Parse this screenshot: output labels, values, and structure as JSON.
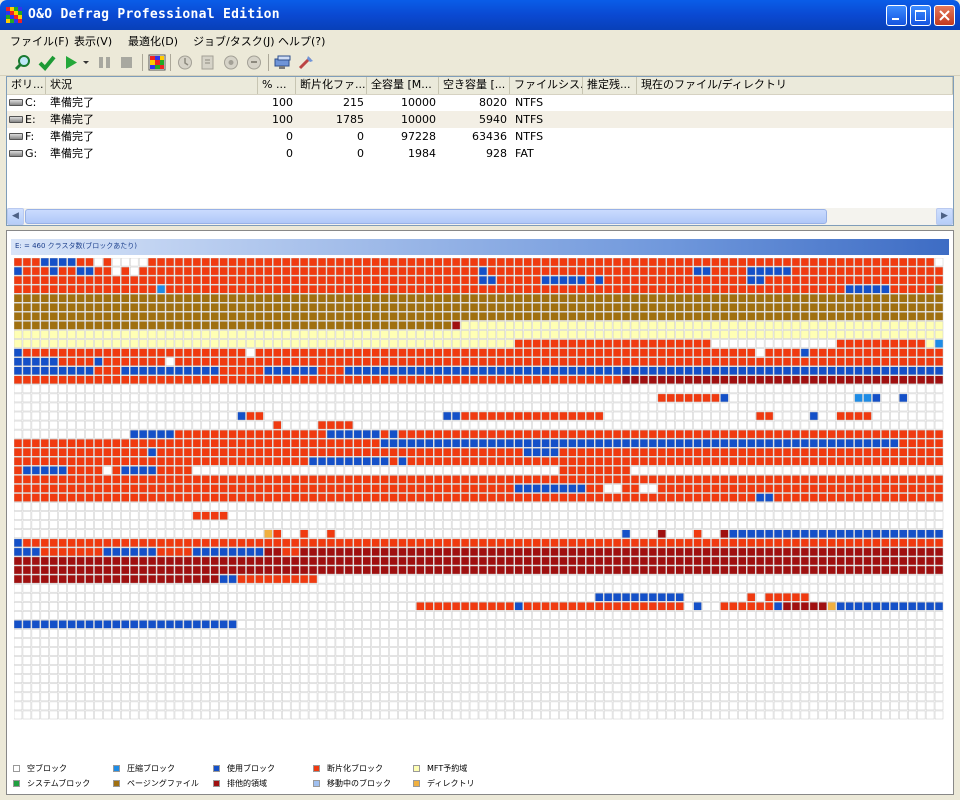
{
  "window": {
    "title": "O&O Defrag Professional Edition"
  },
  "menu": [
    {
      "label": "ファイル(F)"
    },
    {
      "label": "表示(V)"
    },
    {
      "label": "最適化(D)"
    },
    {
      "label": "ジョブ/タスク(J)"
    },
    {
      "label": "ヘルプ(?)"
    }
  ],
  "toolbar": {
    "icons": [
      "analyze-icon",
      "check-icon",
      "start-icon",
      "dropdown-arrow-icon",
      "pause-icon",
      "stop-icon",
      "cluster-view-icon",
      "sched-1-icon",
      "sched-2-icon",
      "sched-3-icon",
      "sched-4-icon",
      "report-icon",
      "settings-icon"
    ]
  },
  "volumes": {
    "columns": [
      "ボリ...",
      "状況",
      "% ...",
      "断片化ファ...",
      "全容量 [M...",
      "空き容量 [...",
      "ファイルシス...",
      "推定残...",
      "現在のファイル/ディレクトリ"
    ],
    "rows": [
      {
        "drive": "C:",
        "status": "準備完了",
        "percent": "100",
        "fragmented": "215",
        "total": "10000",
        "free": "8020",
        "fs": "NTFS",
        "eta": "",
        "current": ""
      },
      {
        "drive": "E:",
        "status": "準備完了",
        "percent": "100",
        "fragmented": "1785",
        "total": "10000",
        "free": "5940",
        "fs": "NTFS",
        "eta": "",
        "current": ""
      },
      {
        "drive": "F:",
        "status": "準備完了",
        "percent": "0",
        "fragmented": "0",
        "total": "97228",
        "free": "63436",
        "fs": "NTFS",
        "eta": "",
        "current": ""
      },
      {
        "drive": "G:",
        "status": "準備完了",
        "percent": "0",
        "fragmented": "0",
        "total": "1984",
        "free": "928",
        "fs": "FAT",
        "eta": "",
        "current": ""
      }
    ],
    "selected_row": 1
  },
  "clustermap": {
    "header": "E: = 460 クラスタ数(ブロックあたり)",
    "grid_cols": 104,
    "grid_rows": 51,
    "colors": {
      "F": "#FFFFFF",
      "R": "#F03A10",
      "B": "#1450C8",
      "N": "#1E8CE6",
      "P": "#A07010",
      "Y": "#FFFFB4",
      "X": "#A01010",
      "S": "#20A040",
      "M": "#A0C0F0",
      "D": "#F0B040"
    },
    "rows": [
      "RRRBBBBRRFRFFFFRRRRRRRRRRRRRRRRRRRRRRRRRRRRRRRRRRRRRRRRRRRRRRRRRRRRRRRRRRRRRRRRRRRRRRRRRRRRRRRRRRRRRRRR",
      "BRRRBRRBBRRFRFRRRRRRRRRRRRRRRRRRRRRRRRRRRRRRRRRRRRRRBRRRRRRRRRRRRRRRRRRRRRRRBBRRRRBBBBBRRRRRRRRRRRRRRRRRR",
      "RRRRRRRRRRRRRRRRRRRRRRRRRRRRRRRRRRRRRRRRRRRRRRRRRRRRBBRRRRRBBBBBRBRRRRRRRRRRRRRRRRBBRRRRRRRRRRRRRRRRRRRR",
      "RRRRRRRRRRRRRRRRNRRRRRRRRRRRRRRRRRRRRRRRRRRRRRRRRRRRRRRRRRRRRRRRRRRRRRRRRRRRRRRRRRRRRRRRRRRRRBBBBBRRRRRP",
      "PPPPPPPPPPPPPPPPPPPPPPPPPPPPPPPPPPPPPPPPPPPPPPPPPPPPPPPPPPPPPPPPPPPPPPPPPPPPPPPPPPPPPPPPPPPPPPPPPPPPPPPPP",
      "PPPPPPPPPPPPPPPPPPPPPPPPPPPPPPPPPPPPPPPPPPPPPPPPPPPPPPPPPPPPPPPPPPPPPPPPPPPPPPPPPPPPPPPPPPPPPPPPPPPPPPPPP",
      "PPPPPPPPPPPPPPPPPPPPPPPPPPPPPPPPPPPPPPPPPPPPPPPPPPPPPPPPPPPPPPPPPPPPPPPPPPPPPPPPPPPPPPPPPPPPPPPPPPPPPPPPP",
      "PPPPPPPPPPPPPPPPPPPPPPPPPPPPPPPPPPPPPPPPPPPPPPPPPXYYYYYYYYYYYYYYYYYYYYYYYYYYYYYYYYYYYYYYYYYYYYYYYYYYYYYYY",
      "YYYYYYYYYYYYYYYYYYYYYYYYYYYYYYYYYYYYYYYYYYYYYYYYYYYYYYYYYYYYYYYYYYYYYYYYYYYYYYYYYYYYYYYYYYYYYYYYYYYYYYYYY",
      "YYYYYYYYYYYYYYYYYYYYYYYYYYYYYYYYYYYYYYYYYYYYYYYYYYYYYYYYRRRRRRRRRRRRRRRRRRRRRRFFFFFFFFFFFFFFRRRRRRRRRRYNY",
      "BRRRRRRRRRRRRRRRRRRRRRRRRRFRRRRRRRRRRRRRRRRRRRRRRRRRRRRRRRRRRRRRRRRRRRRRRRRRRRRRRRRFRRRRBRRRRRRRRRRRRRRRR",
      "BBBBBRRRRBRRRRRRRFRRRRRRRRRRRRRRRRRRRRRRRRRRRRRRRRRRRRRRRRRRRRRRRRRRRRRRRRRRRRRRRRRRRRRRRRRRRRRRRRRRRRRR",
      "BBBBBBBBBRRRBBBBBBBBBBBRRRRRBBBBBBRRRBBBBBBBBBBBBBBBBBBBBBBBBBBBBBBBBBBBBBBBBBBBBBBBBBBBBBBBBBBBBBBBBBBBB",
      "RRRRRRRRRRRRRRRRRRRRRRRRRRRRRRRRRRRRRRRRRRRRRRRRRRRRRRRRRRRRRRRRRRRRXXXXXXXXXXXXXXXXXXXXXXXXXXXXXXXXXXXXX",
      "FFFFFFFFFFFFFFFFFFFFFFFFFFFFFFFFFFFFFFFFFFFFFFFFFFFFFFFFFFFFFFFFFFFFFFFFFFFFFFFFFFFFFFFFFFFFFFFFFFFFFFFFF",
      "FFFFFFFFFFFFFFFFFFFFFFFFFFFFFFFFFFFFFFFFFFFFFFFFFFFFFFFFFFFFFFFFFFFFFFFFRRRRRRRBFFFFFFFFFFFFFFNNBFFBFFFFF",
      "FFFFFFFFFFFFFFFFFFFFFFFFFFFFFFFFFFFFFFFFFFFFFFFFFFFFFFFFFFFFFFFFFFFFFFFFFFFFFFFFFFFFFFFFFFFFFFFFFFFFFFFFF",
      "FFFFFFFFFFFFFFFFFFFFFFFFFBRRFFFFFFFFFFFFFFFFFFFFBBRRRRRRRRRRRRRRRRFFFFFFFFFFFFFFFFFRRFFFFBFFRRRRFFFFFFFFFF",
      "FFFFFFFFFFFFFFFFFFFFFFFFFFFFFRFFFFRRRRFFFFFFFFFFFFFFFFFFFFFFFFFFFFFFFFFFFFFFFFFFFFFFFFFFFFFFFFFFFFFFFFFFF",
      "FFFFFFFFFFFFFBBBBBRRRRRRRRRRRRRRRRRBBBBBBRBRRRRRRRRRRRRRRRRRRRRRRRRRRRRRRRRRRRRRRRRRRRRRRRRRRRRRRRRRRRRR",
      "RRRRRRRRRRRRRRRRRRRRRRRRRRRRRRRRRRRRRRRRRBBBBBBBBBBBBBBBBBBBBBBBBBBBBBBBBBBBBBBBBBBBBBBBBBBBBBBBBBBRRRRRR",
      "RRRRRRRRRRRRRRRBRRRRRRRRRRRRRRRRRRRRRRRRRRRRRRRRRRRRRRRRRBBBBRRRRRRRRRRRRRRRRRRRRRRRRRRRRRRRRRRRRRRRRRRRB",
      "RRRRRRRRRRRRRRRRRRRRRRRRRRRRRRRRRBBBBBBBBBRBRRRRRRRRRRRRRRRRRRRRRRRRRRRRRRRRRRRRRRRRRRRRRRRRRRRRRRRRRRRRR",
      "RBBBBBRRRRFRBBBBRRRRFFFFFFFFFFFFFFFFFFFFFFFFFFFFFFFFFFFFFFFFFRRRRRRRRFFFFFFFFFFFFFFFFFFFFFFFFFFFFFFFFFFFFF",
      "RRRRRRRRRRRRRRRRRRRRRRRRRRRRRRRRRRRRRRRRRRRRRRRRRRRRRRRRRRRRRRRRRRRRRRRRRRRRRRRRRRRRRRRRRRRRRRRRRRRRRRRRR",
      "RRRRRRRRRRRRRRRRRRRRRRRRRRRRRRRRRRRRRRRRRRRRRRRRRRRRRRRRBBBBBBBBRRFFRRFFRRRRRRRRRRRRRRRRRRRRRRRRRRRRRRRRRRR",
      "RRRRRRRRRRRRRRRRRRRRRRRRRRRRRRRRRRRRRRRRRRRRRRRRRRRRRRRRRRRRRRRRRRRRRRRRRRRRRRRRRRRBBRRRRRRRRRRRRRRRRRRRR",
      "FFFFFFFFFFFFFFFFFFFFFFFFFFFFFFFFFFFFFFFFFFFFFFFFFFFFFFFFFFFFFFFFFFFFFFFFFFFFFFFFFFFFFFFFFFFFFFFFFFFFFFFFF",
      "FFFFFFFFFFFFFFFFFFFFRRRRFFFFFFFFFFFFFFFFFFFFFFFFFFFFFFFFFFFFFFFFFFFFFFFFFFFFFFFFFFFFFFFFFFFFFFFFFFFFFFFFF",
      "FFFFFFFFFFFFFFFFFFFFFFFFFFFFFFFFFFFFFFFFFFFFFFFFFFFFFFFFFFFFFFFFFFFFFFFFFFFFFFFFFFFFFFFFFFFFFFFFFFFFFFFFF",
      "FFFFFFFFFFFFFFFFFFFFFFFFFFFFDRFFRFFRFFFFFFFFFFFFFFFFFFFFFFFFFFFFFFFFBFFFXFFFRFFXBBBBBBBBBBBBBBBBBBBBBBBBB",
      "BRRRRRRRRRRRRRRRRRRRRRRRRRRRRRRRRRRRRRRRRRRRRRRRRRRRRRRRRRRRRRRRRRRRRRRRRRRRRRRRRRRRRRRRRRRRRRRRRRRRRRRRR",
      "BBBRRRRRRRBBBBBBRRRRBBBBBBBBXXRRXXXXXXXXXXXXXXXXXXXXXXXXXXXXXXXXXXXXXXXXXXXXXXXXXXXXXXXXXXXXXXXXXXXXXXXXX",
      "XXXXXXXXXXXXXXXXXXXXXXXXXXXXXXXXXXXXXXXXXXXXXXXXXXXXXXXXXXXXXXXXXXXXXXXXXXXXXXXXXXXXXXXXXXXXXXXXXXXXXXXXX",
      "XXXXXXXXXXXXXXXXXXXXXXXXXXXXXXXXXXXXXXXXXXXXXXXXXXXXXXXXXXXXXXXXXXXXXXXXXXXXXXXXXXXXXXXXXXXXXXXXXXXXXXXXX",
      "XXXXXXXXXXXXXXXXXXXXXXXBBRRRRRRRRRFFFFFFFFFFFFFFFFFFFFFFFFFFFFFFFFFFFFFFFFFFFFFFFFFFFFFFFFFFFFFFFFFFFFFF",
      "FFFFFFFFFFFFFFFFFFFFFFFFFFFFFFFFFFFFFFFFFFFFFFFFFFFFFFFFFFFFFFFFFFFFFFFFFFFFFFFFFFFFFFFFFFFFFFFFFFFFFFFFF",
      "FFFFFFFFFFFFFFFFFFFFFFFFFFFFFFFFFFFFFFFFFFFFFFFFFFFFFFFFFFFFFFFFFBBBBBBBBBBFFFFFFFRFRRRRRFFFFFFFFFFFFFFFFF",
      "FFFFFFFFFFFFFFFFFFFFFFFFFFFFFFFFFFFFFFFFFFFFFRRRRRRRRRRRBRRRRRRRRRRRRRRRRRRFBFFRRRRRRBXXXXXDBBBBBBBBBBBBBB",
      "FFFFFFFFFFFFFFFFFFFFFFFFFFFFFFFFFFFFFFFFFFFFFFFFFFFFFFFFFFFFFFFFFFFFFFFFFFFFFFFFFFFFFFFFFFFFFFFFFFFFFFFFF",
      "BBBBBBBBBBBBBBBBBBBBBBBBBFFFFFFFFFFFFFFFFFFFFFFFFFFFFFFFFFFFFFFFFFFFFFFFFFFFFFFFFFFFFFFFFFFFFFFFFFFFFFFFF",
      "FFFFFFFFFFFFFFFFFFFFFFFFFFFFFFFFFFFFFFFFFFFFFFFFFFFFFFFFFFFFFFFFFFFFFFFFFFFFFFFFFFFFFFFFFFFFFFFFFFFFFFFFF",
      "FFFFFFFFFFFFFFFFFFFFFFFFFFFFFFFFFFFFFFFFFFFFFFFFFFFFFFFFFFFFFFFFFFFFFFFFFFFFFFFFFFFFFFFFFFFFFFFFFFFFFFFFF",
      "FFFFFFFFFFFFFFFFFFFFFFFFFFFFFFFFFFFFFFFFFFFFFFFFFFFFFFFFFFFFFFFFFFFFFFFFFFFFFFFFFFFFFFFFFFFFFFFFFFFFFFFFF",
      "FFFFFFFFFFFFFFFFFFFFFFFFFFFFFFFFFFFFFFFFFFFFFFFFFFFFFFFFFFFFFFFFFFFFFFFFFFFFFFFFFFFFFFFFFFFFFFFFFFFFFFFFF",
      "FFFFFFFFFFFFFFFFFFFFFFFFFFFFFFFFFFFFFFFFFFFFFFFFFFFFFFFFFFFFFFFFFFFFFFFFFFFFFFFFFFFFFFFFFFFFFFFFFFFFFFFFF",
      "FFFFFFFFFFFFFFFFFFFFFFFFFFFFFFFFFFFFFFFFFFFFFFFFFFFFFFFFFFFFFFFFFFFFFFFFFFFFFFFFFFFFFFFFFFFFFFFFFFFFFFFFF",
      "FFFFFFFFFFFFFFFFFFFFFFFFFFFFFFFFFFFFFFFFFFFFFFFFFFFFFFFFFFFFFFFFFFFFFFFFFFFFFFFFFFFFFFFFFFFFFFFFFFFFFFFFF",
      "FFFFFFFFFFFFFFFFFFFFFFFFFFFFFFFFFFFFFFFFFFFFFFFFFFFFFFFFFFFFFFFFFFFFFFFFFFFFFFFFFFFFFFFFFFFFFFFFFFFFFFFFF",
      "FFFFFFFFFFFFFFFFFFFFFFFFFFFFFFFFFFFFFFFFFFFFFFFFFFFFFFFFFFFFFFFFFFFFFFFFFFFFFFFFFFFFFFFFFFFFFFFFFFFFFFFFF",
      "FFFFFFFFFFFFFFFFFFFFFFFFFFFFFFFFFFFFFFFFFFFFFFFFFFFFFFFFFFFFFFFFFFFFFFFFFFFFFFFFFFFFFFFFFFFFFFFFFFFFFFFFF"
    ]
  },
  "legend": [
    {
      "label": "空ブロック",
      "color": "#FFFFFF"
    },
    {
      "label": "圧縮ブロック",
      "color": "#1E8CE6"
    },
    {
      "label": "使用ブロック",
      "color": "#1450C8"
    },
    {
      "label": "断片化ブロック",
      "color": "#F03A10"
    },
    {
      "label": "MFT予約域",
      "color": "#FFFFB4"
    },
    {
      "label": "システムブロック",
      "color": "#20A040"
    },
    {
      "label": "ページングファイル",
      "color": "#A07010"
    },
    {
      "label": "排他的領域",
      "color": "#A01010"
    },
    {
      "label": "移動中のブロック",
      "color": "#A0C0F0"
    },
    {
      "label": "ディレクトリ",
      "color": "#F0B040"
    }
  ]
}
